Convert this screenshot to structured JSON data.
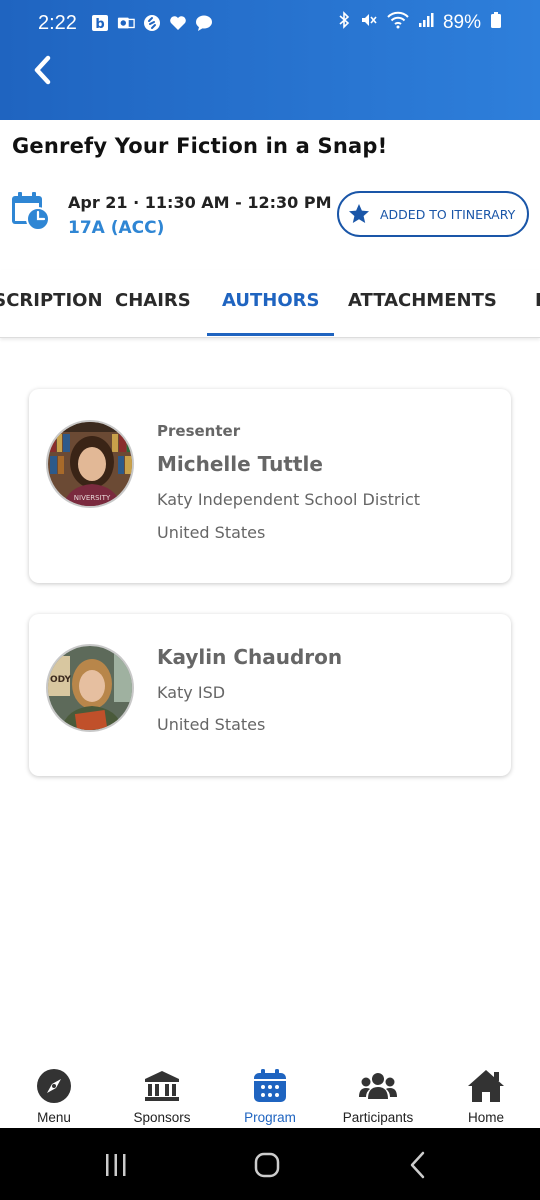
{
  "status_bar": {
    "time": "2:22",
    "battery": "89%",
    "notification_icons": [
      "b-icon",
      "outlook-icon",
      "shazam-icon",
      "heart-icon",
      "chat-icon"
    ],
    "system_icons": [
      "bluetooth-icon",
      "mute-icon",
      "wifi-icon",
      "signal-icon",
      "battery-icon"
    ]
  },
  "header": {
    "back_icon": "chevron-left-icon"
  },
  "session": {
    "title": "Genrefy Your Fiction in a Snap!",
    "time": "Apr 21 · 11:30 AM - 12:30 PM",
    "room": "17A (ACC)",
    "itinerary_label": "ADDED TO ITINERARY"
  },
  "tabs": [
    {
      "label": "DESCRIPTION"
    },
    {
      "label": "CHAIRS"
    },
    {
      "label": "AUTHORS"
    },
    {
      "label": "ATTACHMENTS"
    },
    {
      "label": "I"
    }
  ],
  "authors": [
    {
      "role": "Presenter",
      "name": "Michelle Tuttle",
      "organization": "Katy Independent School District",
      "country": "United States"
    },
    {
      "role": "",
      "name": "Kaylin Chaudron",
      "organization": "Katy ISD",
      "country": "United States"
    }
  ],
  "bottom_nav": [
    {
      "label": "Menu",
      "icon": "compass-icon"
    },
    {
      "label": "Sponsors",
      "icon": "bank-icon"
    },
    {
      "label": "Program",
      "icon": "calendar-icon"
    },
    {
      "label": "Participants",
      "icon": "people-icon"
    },
    {
      "label": "Home",
      "icon": "home-icon"
    }
  ],
  "colors": {
    "primary": "#1f64c0",
    "accent_light": "#2f86d4",
    "text_muted": "#666666"
  }
}
